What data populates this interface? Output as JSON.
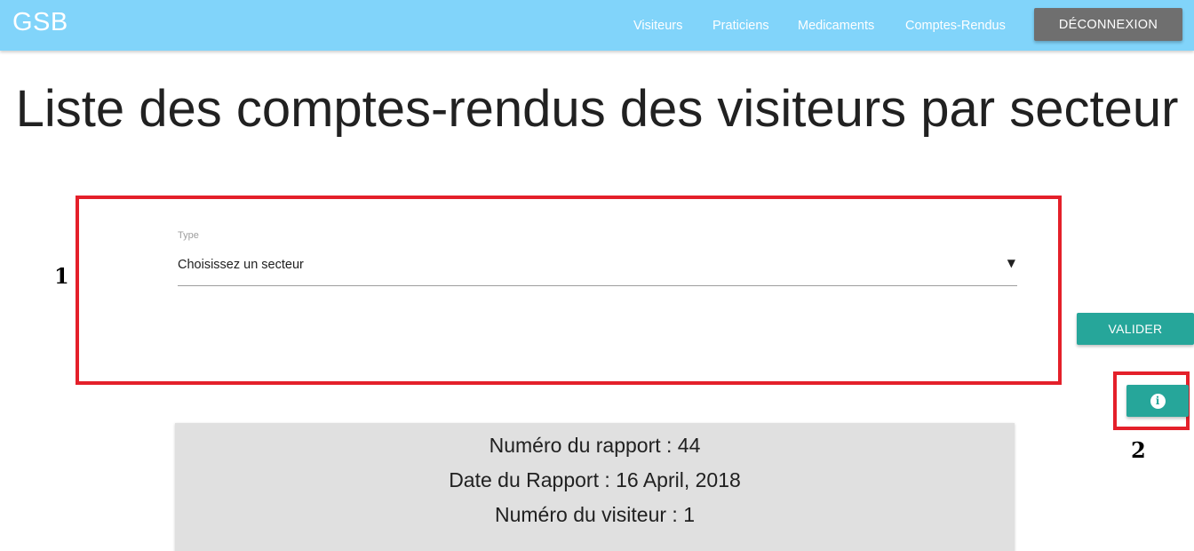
{
  "navbar": {
    "brand": "GSB",
    "links": [
      "Visiteurs",
      "Praticiens",
      "Medicaments",
      "Comptes-Rendus"
    ],
    "logout_label": "DÉCONNEXION",
    "bg_color": "#81d4fa"
  },
  "title": "Liste des comptes-rendus des visiteurs par secteur",
  "filter": {
    "label": "Type",
    "selected_value": "Choisissez un secteur"
  },
  "buttons": {
    "valider_label": "VALIDER",
    "info_icon": "info-icon",
    "info_glyph": "i"
  },
  "annotations": {
    "box1_label": "1",
    "box2_label": "2",
    "color": "#e4202a"
  },
  "report": {
    "numero_rapport": "Numéro du rapport : 44",
    "date_rapport": "Date du Rapport : 16 April, 2018",
    "numero_visiteur": "Numéro du visiteur : 1"
  },
  "colors": {
    "accent": "#26a69a",
    "logout_bg": "#6f6f6f",
    "card_bg": "#e0e0e0"
  }
}
